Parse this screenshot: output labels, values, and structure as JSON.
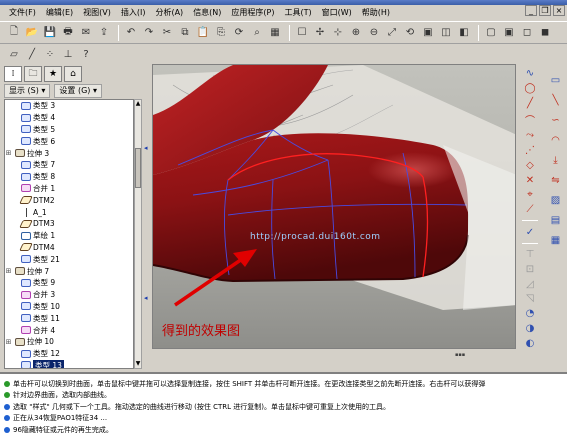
{
  "menu": {
    "items": [
      "文件(F)",
      "编辑(E)",
      "视图(V)",
      "插入(I)",
      "分析(A)",
      "信息(N)",
      "应用程序(P)",
      "工具(T)",
      "窗口(W)",
      "帮助(H)"
    ]
  },
  "nav": {
    "show_label": "显示 (S) ▾",
    "settings_label": "设置 (G) ▾"
  },
  "tree": {
    "items": [
      {
        "label": "类型 3",
        "kind": "curve",
        "indent": 1,
        "expandable": false
      },
      {
        "label": "类型 4",
        "kind": "curve",
        "indent": 1,
        "expandable": false
      },
      {
        "label": "类型 5",
        "kind": "curve",
        "indent": 1,
        "expandable": false
      },
      {
        "label": "类型 6",
        "kind": "curve",
        "indent": 1,
        "expandable": false
      },
      {
        "label": "拉伸 3",
        "kind": "extrude",
        "indent": 0,
        "expandable": true
      },
      {
        "label": "类型 7",
        "kind": "curve",
        "indent": 1,
        "expandable": false
      },
      {
        "label": "类型 8",
        "kind": "curve",
        "indent": 1,
        "expandable": false
      },
      {
        "label": "合并 1",
        "kind": "merge",
        "indent": 1,
        "expandable": false
      },
      {
        "label": "DTM2",
        "kind": "plane",
        "indent": 1,
        "expandable": false
      },
      {
        "label": "A_1",
        "kind": "axis",
        "indent": 1,
        "expandable": false
      },
      {
        "label": "DTM3",
        "kind": "plane",
        "indent": 1,
        "expandable": false
      },
      {
        "label": "草绘 1",
        "kind": "sketch",
        "indent": 1,
        "expandable": false
      },
      {
        "label": "DTM4",
        "kind": "plane",
        "indent": 1,
        "expandable": false
      },
      {
        "label": "类型 21",
        "kind": "curve",
        "indent": 1,
        "expandable": false
      },
      {
        "label": "拉伸 7",
        "kind": "extrude",
        "indent": 0,
        "expandable": true
      },
      {
        "label": "类型 9",
        "kind": "curve",
        "indent": 1,
        "expandable": false
      },
      {
        "label": "合并 3",
        "kind": "merge",
        "indent": 1,
        "expandable": false
      },
      {
        "label": "类型 10",
        "kind": "curve",
        "indent": 1,
        "expandable": false
      },
      {
        "label": "类型 11",
        "kind": "curve",
        "indent": 1,
        "expandable": false
      },
      {
        "label": "合并 4",
        "kind": "merge",
        "indent": 1,
        "expandable": false
      },
      {
        "label": "拉伸 10",
        "kind": "extrude",
        "indent": 0,
        "expandable": true
      },
      {
        "label": "类型 12",
        "kind": "curve",
        "indent": 1,
        "expandable": false
      },
      {
        "label": "类型 13",
        "kind": "curve",
        "indent": 1,
        "expandable": false,
        "selected": true
      }
    ]
  },
  "viewport": {
    "annotation": "得到的效果图",
    "watermark": "http://procad.dui160t.com"
  },
  "messages": [
    {
      "bullet": "green",
      "text": "单击杆可以切换到时曲面，单击鼠标中键并拖可以选择复制连接，按住 SHIFT 并单击杆可断开连接。在更改连接类型之前先断开连接。右击杆可以获得弹"
    },
    {
      "bullet": "green",
      "text": "针对边界曲面，选取内部曲线。"
    },
    {
      "bullet": "blue",
      "text": "选取 \"样式\" 几何或下一个工具。拖动选定的曲线进行移动 (按住 CTRL 进行复制)。单击鼠标中键可重复上次使用的工具。"
    },
    {
      "bullet": "blue",
      "text": "正在从34恢复PAO1特征34 ..."
    },
    {
      "bullet": "blue",
      "text": "96隐藏特征或元件的再生完成。"
    }
  ],
  "colors": {
    "body_red": "#8b1214",
    "body_red_dark": "#5a0a0c",
    "annotation_red": "#e00000",
    "selection_blue": "#0a246a"
  }
}
